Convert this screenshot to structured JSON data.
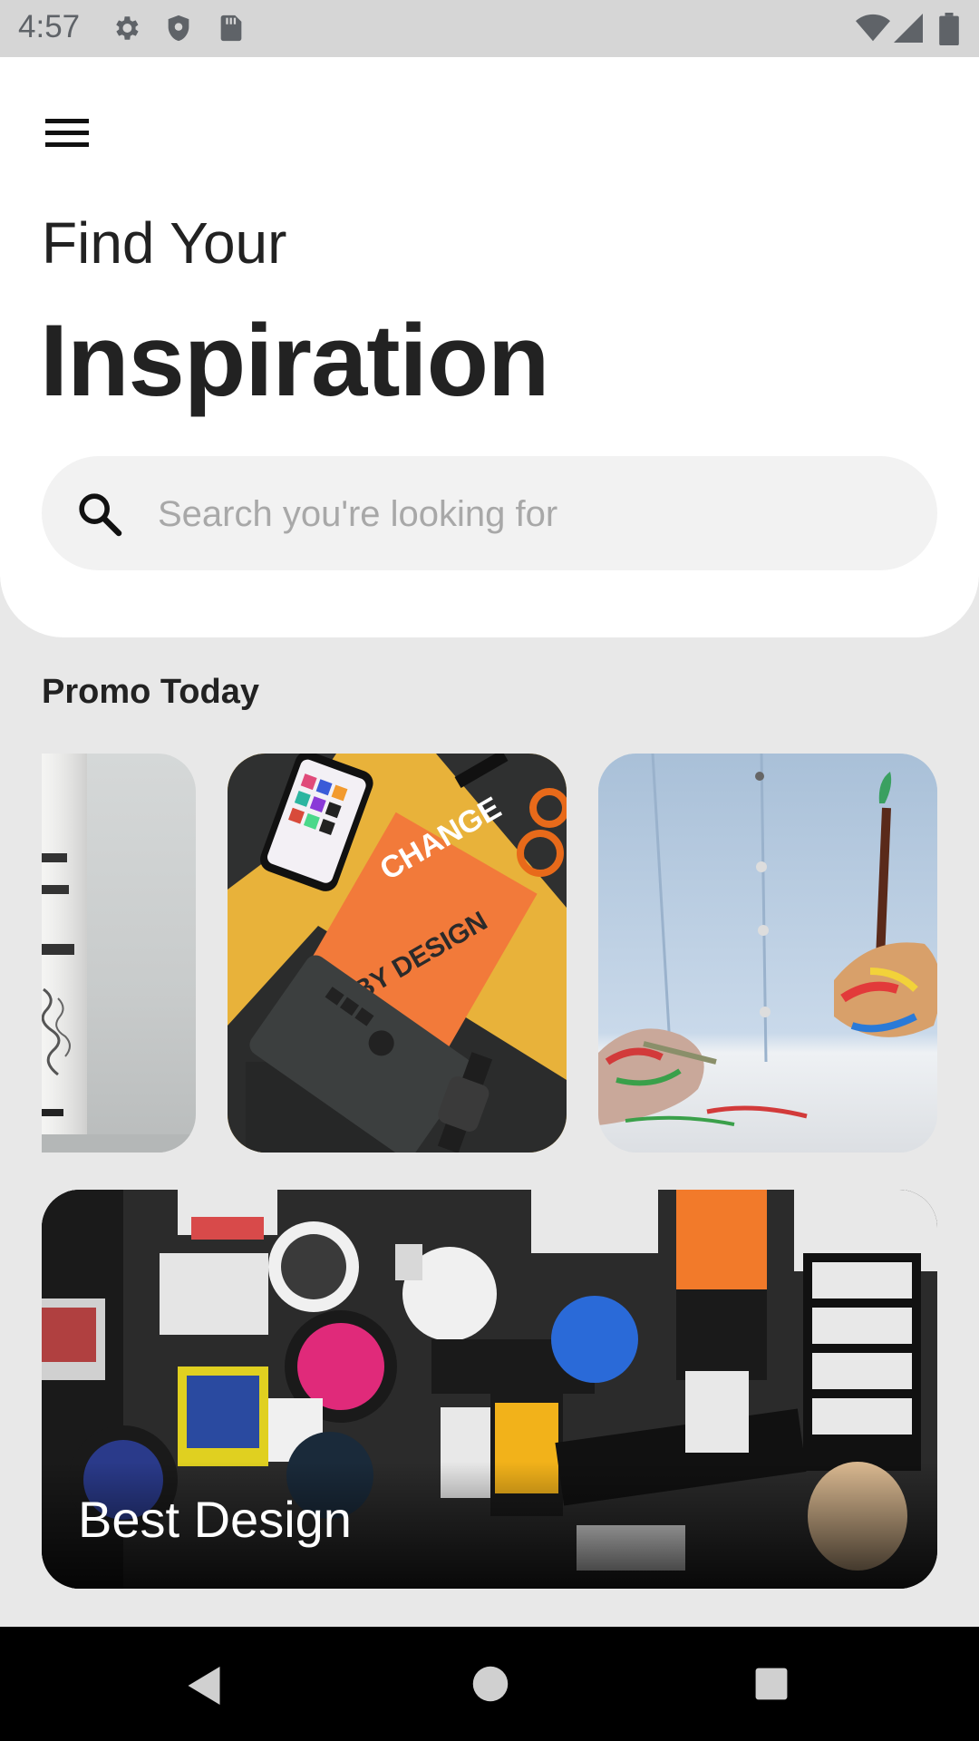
{
  "status_bar": {
    "time": "4:57",
    "icons": [
      "settings-icon",
      "shield-icon",
      "sd-card-icon",
      "wifi-icon",
      "signal-icon",
      "battery-icon"
    ]
  },
  "header": {
    "menu_icon": "hamburger-menu-icon",
    "title_line1": "Find Your",
    "title_line2": "Inspiration"
  },
  "search": {
    "placeholder": "Search you're looking for",
    "value": ""
  },
  "promo": {
    "section_title": "Promo Today",
    "cards": [
      {
        "name": "promo-card-mixed-water",
        "image": "water-bottle-photo"
      },
      {
        "name": "promo-card-change-by-design",
        "image": "change-by-design-book-photo"
      },
      {
        "name": "promo-card-paint-brush",
        "image": "painting-hands-photo"
      }
    ]
  },
  "featured": {
    "label": "Best Design",
    "image": "sticker-wall-photo"
  },
  "nav_bar": {
    "icons": [
      "back-icon",
      "home-icon",
      "recents-icon"
    ]
  },
  "colors": {
    "background": "#e8e8e8",
    "card": "#ffffff",
    "search_bg": "#f2f2f2",
    "title_text": "#222222",
    "placeholder": "#a8a8a8"
  }
}
